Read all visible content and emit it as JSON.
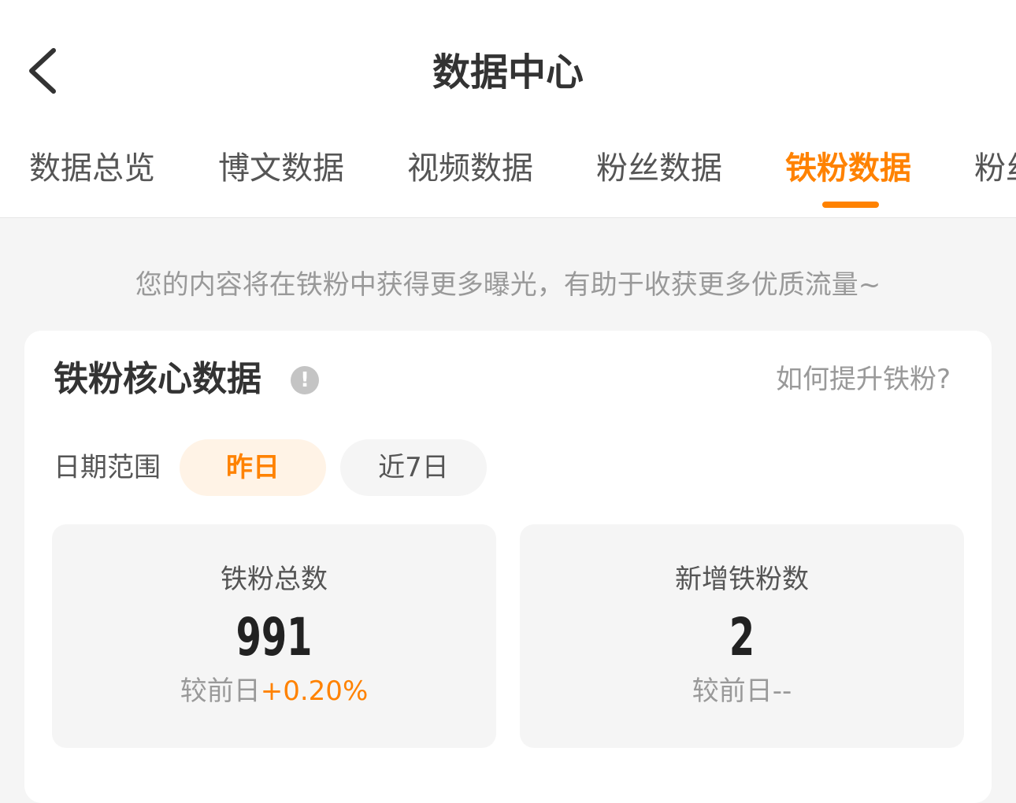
{
  "header": {
    "title": "数据中心",
    "back_icon": "chevron-left-icon"
  },
  "tabs": [
    {
      "label": "数据总览",
      "active": false
    },
    {
      "label": "博文数据",
      "active": false
    },
    {
      "label": "视频数据",
      "active": false
    },
    {
      "label": "粉丝数据",
      "active": false
    },
    {
      "label": "铁粉数据",
      "active": true
    },
    {
      "label": "粉丝",
      "active": false
    }
  ],
  "notice": "您的内容将在铁粉中获得更多曝光，有助于收获更多优质流量~",
  "core_card": {
    "title": "铁粉核心数据",
    "info_icon": "exclamation-circle-icon",
    "info_glyph": "!",
    "help_link": "如何提升铁粉?",
    "date_range": {
      "label": "日期范围",
      "options": [
        {
          "label": "昨日",
          "selected": true
        },
        {
          "label": "近7日",
          "selected": false
        }
      ]
    },
    "stats": [
      {
        "label": "铁粉总数",
        "value": "991",
        "compare_prefix": "较前日",
        "compare_value": "+0.20%"
      },
      {
        "label": "新增铁粉数",
        "value": "2",
        "compare_prefix": "较前日",
        "compare_value": "--"
      }
    ]
  },
  "colors": {
    "accent": "#ff8200",
    "accent_bg": "#fff3e6",
    "page_bg": "#f5f5f5",
    "card_bg": "#ffffff",
    "muted_text": "#999999"
  }
}
